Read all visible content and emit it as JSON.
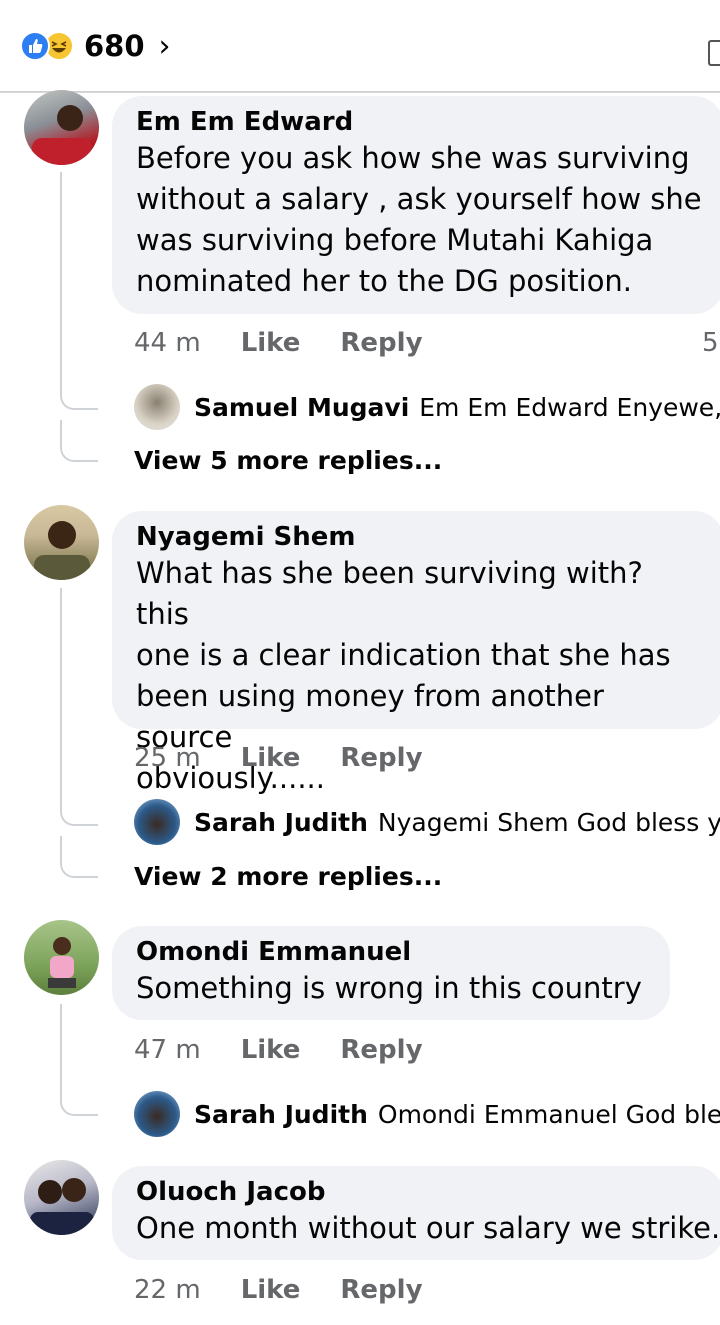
{
  "header": {
    "reactions": [
      "like",
      "haha"
    ],
    "count": "680",
    "chevron": "›"
  },
  "comments": [
    {
      "name": "Em Em Edward",
      "lines": [
        "Before you ask how she was surviving",
        "without a salary , ask yourself how she",
        "was surviving before Mutahi Kahiga",
        "nominated her to the DG position."
      ],
      "time": "44 m",
      "like": "Like",
      "reply": "Reply",
      "count": "5",
      "reply_preview": {
        "name": "Samuel Mugavi",
        "text": "Em Em Edward Enyewe, sh"
      },
      "more": "View 5 more replies..."
    },
    {
      "name": "Nyagemi Shem",
      "lines": [
        "What has she been surviving with? this",
        "one is a clear indication that she has",
        "been using money from another source",
        "obviously......"
      ],
      "time": "25 m",
      "like": "Like",
      "reply": "Reply",
      "reply_preview": {
        "name": "Sarah Judith",
        "text": "Nyagemi Shem God bless you"
      },
      "more": "View 2 more replies..."
    },
    {
      "name": "Omondi Emmanuel",
      "lines": [
        "Something is wrong in this country"
      ],
      "time": "47 m",
      "like": "Like",
      "reply": "Reply",
      "reply_preview": {
        "name": "Sarah Judith",
        "text": "Omondi Emmanuel God bless"
      }
    },
    {
      "name": "Oluoch Jacob",
      "lines": [
        "One month without our salary we strike."
      ],
      "time": "22 m",
      "like": "Like",
      "reply": "Reply"
    }
  ],
  "colors": {
    "bubble": "#f0f2f5",
    "meta": "#65676b",
    "like_blue": "#2d7ef2",
    "haha_yellow": "#f7c531"
  }
}
